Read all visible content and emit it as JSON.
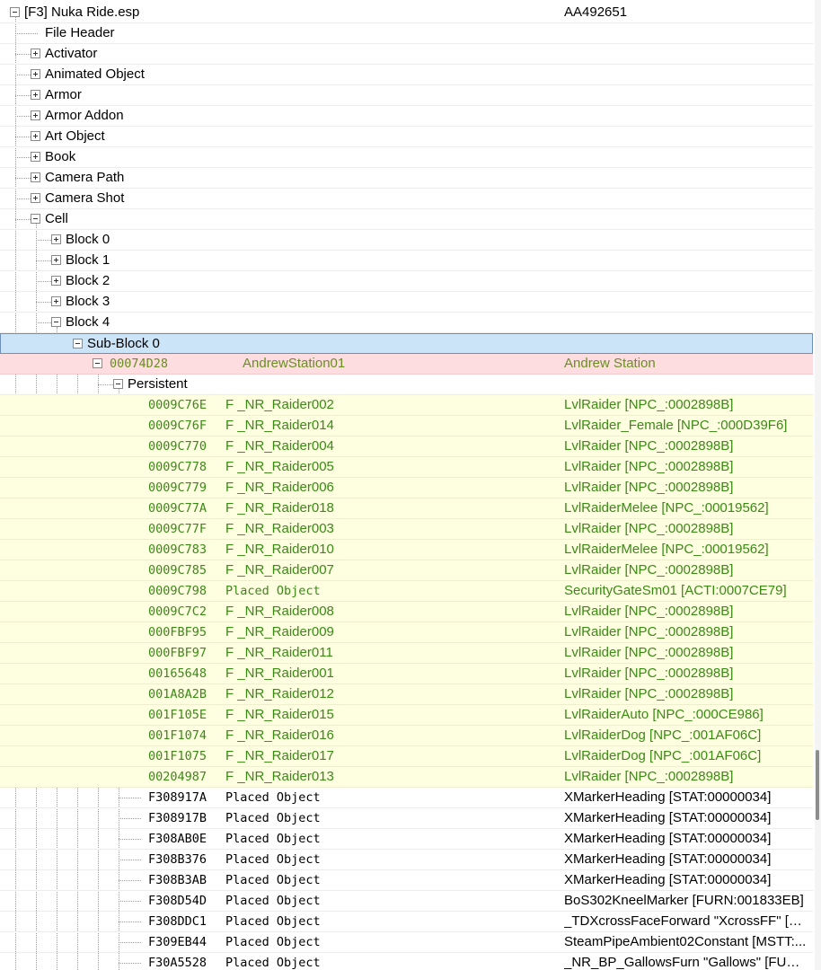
{
  "tree": {
    "rows": [
      {
        "level": 0,
        "expander": "minus",
        "label": "[F3] Nuka Ride.esp",
        "value": "AA492651",
        "style": "normal"
      },
      {
        "level": 1,
        "expander": "none",
        "label": "File Header",
        "value": "",
        "style": "normal"
      },
      {
        "level": 1,
        "expander": "plus",
        "label": "Activator",
        "value": "",
        "style": "normal"
      },
      {
        "level": 1,
        "expander": "plus",
        "label": "Animated Object",
        "value": "",
        "style": "normal"
      },
      {
        "level": 1,
        "expander": "plus",
        "label": "Armor",
        "value": "",
        "style": "normal"
      },
      {
        "level": 1,
        "expander": "plus",
        "label": "Armor Addon",
        "value": "",
        "style": "normal"
      },
      {
        "level": 1,
        "expander": "plus",
        "label": "Art Object",
        "value": "",
        "style": "normal"
      },
      {
        "level": 1,
        "expander": "plus",
        "label": "Book",
        "value": "",
        "style": "normal"
      },
      {
        "level": 1,
        "expander": "plus",
        "label": "Camera Path",
        "value": "",
        "style": "normal"
      },
      {
        "level": 1,
        "expander": "plus",
        "label": "Camera Shot",
        "value": "",
        "style": "normal"
      },
      {
        "level": 1,
        "expander": "minus",
        "label": "Cell",
        "value": "",
        "style": "normal"
      },
      {
        "level": 2,
        "expander": "plus",
        "label": "Block 0",
        "value": "",
        "style": "normal"
      },
      {
        "level": 2,
        "expander": "plus",
        "label": "Block 1",
        "value": "",
        "style": "normal"
      },
      {
        "level": 2,
        "expander": "plus",
        "label": "Block 2",
        "value": "",
        "style": "normal"
      },
      {
        "level": 2,
        "expander": "plus",
        "label": "Block 3",
        "value": "",
        "style": "normal"
      },
      {
        "level": 2,
        "expander": "minus",
        "label": "Block 4",
        "value": "",
        "style": "normal"
      },
      {
        "level": 3,
        "expander": "minus",
        "label": "Sub-Block 0",
        "value": "",
        "style": "selected"
      },
      {
        "level": 4,
        "expander": "minus",
        "formid": "00074D28",
        "label": "AndrewStation01",
        "value": "Andrew Station",
        "style": "pink"
      },
      {
        "level": 5,
        "expander": "minus",
        "label": "Persistent",
        "value": "",
        "style": "normal"
      },
      {
        "level": 6,
        "expander": "none",
        "formid": "0009C76E",
        "label": "F _NR_Raider002",
        "value": "LvlRaider [NPC_:0002898B]",
        "style": "yellow"
      },
      {
        "level": 6,
        "expander": "none",
        "formid": "0009C76F",
        "label": "F _NR_Raider014",
        "value": "LvlRaider_Female [NPC_:000D39F6]",
        "style": "yellow"
      },
      {
        "level": 6,
        "expander": "none",
        "formid": "0009C770",
        "label": "F _NR_Raider004",
        "value": "LvlRaider [NPC_:0002898B]",
        "style": "yellow"
      },
      {
        "level": 6,
        "expander": "none",
        "formid": "0009C778",
        "label": "F _NR_Raider005",
        "value": "LvlRaider [NPC_:0002898B]",
        "style": "yellow"
      },
      {
        "level": 6,
        "expander": "none",
        "formid": "0009C779",
        "label": "F _NR_Raider006",
        "value": "LvlRaider [NPC_:0002898B]",
        "style": "yellow"
      },
      {
        "level": 6,
        "expander": "none",
        "formid": "0009C77A",
        "label": "F _NR_Raider018",
        "value": "LvlRaiderMelee [NPC_:00019562]",
        "style": "yellow"
      },
      {
        "level": 6,
        "expander": "none",
        "formid": "0009C77F",
        "label": "F _NR_Raider003",
        "value": "LvlRaider [NPC_:0002898B]",
        "style": "yellow"
      },
      {
        "level": 6,
        "expander": "none",
        "formid": "0009C783",
        "label": "F _NR_Raider010",
        "value": "LvlRaiderMelee [NPC_:00019562]",
        "style": "yellow"
      },
      {
        "level": 6,
        "expander": "none",
        "formid": "0009C785",
        "label": "F _NR_Raider007",
        "value": "LvlRaider [NPC_:0002898B]",
        "style": "yellow"
      },
      {
        "level": 6,
        "expander": "none",
        "formid": "0009C798",
        "label": "Placed Object",
        "value": "SecurityGateSm01 [ACTI:0007CE79]",
        "style": "yellow"
      },
      {
        "level": 6,
        "expander": "none",
        "formid": "0009C7C2",
        "label": "F _NR_Raider008",
        "value": "LvlRaider [NPC_:0002898B]",
        "style": "yellow"
      },
      {
        "level": 6,
        "expander": "none",
        "formid": "000FBF95",
        "label": "F _NR_Raider009",
        "value": "LvlRaider [NPC_:0002898B]",
        "style": "yellow"
      },
      {
        "level": 6,
        "expander": "none",
        "formid": "000FBF97",
        "label": "F _NR_Raider011",
        "value": "LvlRaider [NPC_:0002898B]",
        "style": "yellow"
      },
      {
        "level": 6,
        "expander": "none",
        "formid": "00165648",
        "label": "F _NR_Raider001",
        "value": "LvlRaider [NPC_:0002898B]",
        "style": "yellow"
      },
      {
        "level": 6,
        "expander": "none",
        "formid": "001A8A2B",
        "label": "F _NR_Raider012",
        "value": "LvlRaider [NPC_:0002898B]",
        "style": "yellow"
      },
      {
        "level": 6,
        "expander": "none",
        "formid": "001F105E",
        "label": "F _NR_Raider015",
        "value": "LvlRaiderAuto [NPC_:000CE986]",
        "style": "yellow"
      },
      {
        "level": 6,
        "expander": "none",
        "formid": "001F1074",
        "label": "F _NR_Raider016",
        "value": "LvlRaiderDog [NPC_:001AF06C]",
        "style": "yellow"
      },
      {
        "level": 6,
        "expander": "none",
        "formid": "001F1075",
        "label": "F _NR_Raider017",
        "value": "LvlRaiderDog [NPC_:001AF06C]",
        "style": "yellow"
      },
      {
        "level": 6,
        "expander": "none",
        "formid": "00204987",
        "label": "F _NR_Raider013",
        "value": "LvlRaider [NPC_:0002898B]",
        "style": "yellow"
      },
      {
        "level": 6,
        "expander": "none",
        "formid": "F308917A",
        "label": "Placed Object",
        "value": "XMarkerHeading [STAT:00000034]",
        "style": "normal"
      },
      {
        "level": 6,
        "expander": "none",
        "formid": "F308917B",
        "label": "Placed Object",
        "value": "XMarkerHeading [STAT:00000034]",
        "style": "normal"
      },
      {
        "level": 6,
        "expander": "none",
        "formid": "F308AB0E",
        "label": "Placed Object",
        "value": "XMarkerHeading [STAT:00000034]",
        "style": "normal"
      },
      {
        "level": 6,
        "expander": "none",
        "formid": "F308B376",
        "label": "Placed Object",
        "value": "XMarkerHeading [STAT:00000034]",
        "style": "normal"
      },
      {
        "level": 6,
        "expander": "none",
        "formid": "F308B3AB",
        "label": "Placed Object",
        "value": "XMarkerHeading [STAT:00000034]",
        "style": "normal"
      },
      {
        "level": 6,
        "expander": "none",
        "formid": "F308D54D",
        "label": "Placed Object",
        "value": "BoS302KneelMarker [FURN:001833EB]",
        "style": "normal"
      },
      {
        "level": 6,
        "expander": "none",
        "formid": "F308DDC1",
        "label": "Placed Object",
        "value": "_TDXcrossFaceForward \"XcrossFF\" [FU...",
        "style": "normal"
      },
      {
        "level": 6,
        "expander": "none",
        "formid": "F309EB44",
        "label": "Placed Object",
        "value": "SteamPipeAmbient02Constant [MSTT:...",
        "style": "normal"
      },
      {
        "level": 6,
        "expander": "none",
        "formid": "F30A5528",
        "label": "Placed Object",
        "value": "_NR_BP_GallowsFurn \"Gallows\" [FURN:...",
        "style": "normal"
      }
    ]
  }
}
